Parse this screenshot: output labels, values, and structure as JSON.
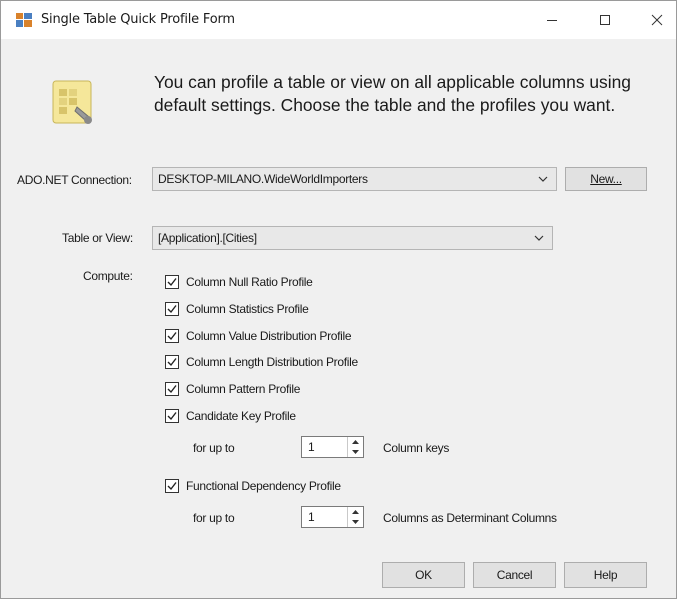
{
  "window": {
    "title": "Single Table Quick Profile Form"
  },
  "intro": {
    "text": "You can profile a table or view on all applicable columns using default settings. Choose the table and the profiles you want."
  },
  "connection": {
    "label": "ADO.NET Connection:",
    "value": "DESKTOP-MILANO.WideWorldImporters",
    "new_button": "New..."
  },
  "table": {
    "label": "Table or View:",
    "value": "[Application].[Cities]"
  },
  "compute": {
    "label": "Compute:",
    "profiles": [
      {
        "label": "Column Null Ratio Profile",
        "checked": true
      },
      {
        "label": "Column Statistics Profile",
        "checked": true
      },
      {
        "label": "Column Value Distribution Profile",
        "checked": true
      },
      {
        "label": "Column Length Distribution Profile",
        "checked": true
      },
      {
        "label": "Column Pattern Profile",
        "checked": true
      },
      {
        "label": "Candidate Key Profile",
        "checked": true
      },
      {
        "label": "Functional Dependency Profile",
        "checked": true
      }
    ],
    "candidate_key": {
      "prefix": "for up to",
      "value": "1",
      "suffix": "Column keys"
    },
    "functional_dependency": {
      "prefix": "for up to",
      "value": "1",
      "suffix": "Columns as Determinant Columns"
    }
  },
  "buttons": {
    "ok": "OK",
    "cancel": "Cancel",
    "help": "Help"
  },
  "icons": {
    "app": "ssis-profile-icon",
    "hero": "profile-wizard-icon",
    "minimize": "minimize-icon",
    "maximize": "maximize-icon",
    "close": "close-icon",
    "dropdown": "chevron-down-icon",
    "check": "checkmark-icon",
    "spin_up": "triangle-up-icon",
    "spin_down": "triangle-down-icon"
  },
  "colors": {
    "window_bg": "#f0f0f0",
    "title_bg": "#ffffff",
    "combo_bg": "#e8e8e8"
  }
}
